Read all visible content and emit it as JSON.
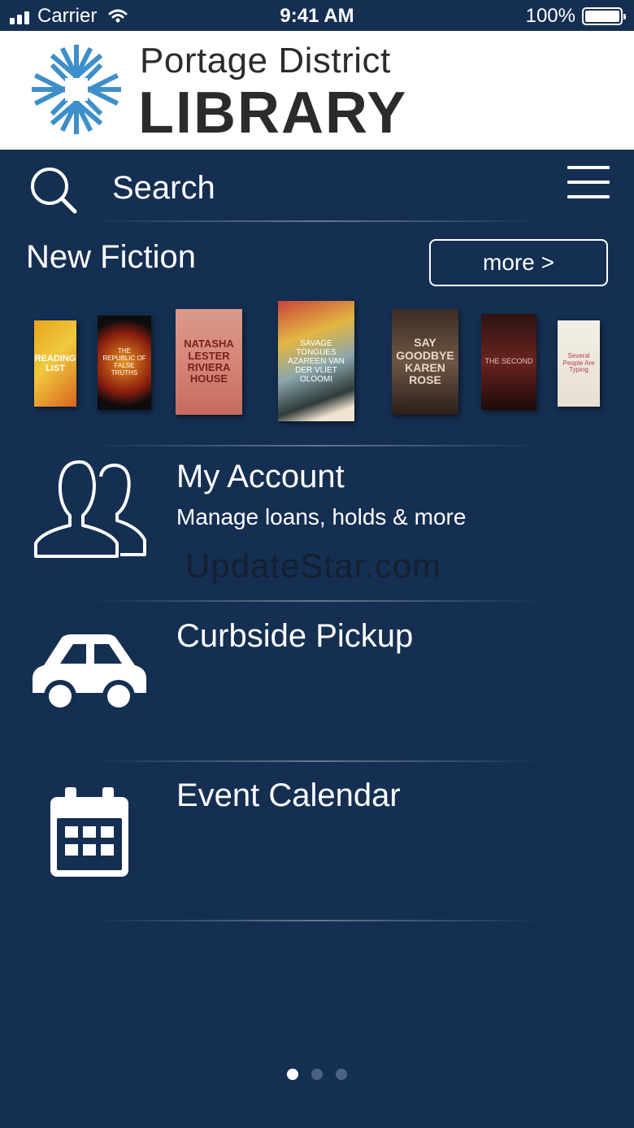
{
  "status_bar": {
    "carrier": "Carrier",
    "time": "9:41 AM",
    "battery": "100%"
  },
  "header": {
    "logo_line1": "Portage District",
    "logo_line2": "LIBRARY",
    "logo_color": "#3d8fca"
  },
  "search": {
    "placeholder": "Search",
    "icon": "search-icon"
  },
  "menu": {
    "icon": "hamburger-menu-icon"
  },
  "new_fiction": {
    "title": "New Fiction",
    "more_label": "more >",
    "covers": [
      {
        "title": "The Reading List",
        "text": "READING LIST"
      },
      {
        "title": "The Republic of False Truths",
        "text": "THE REPUBLIC OF FALSE TRUTHS"
      },
      {
        "title": "Riviera House",
        "text": "NATASHA LESTER RIVIERA HOUSE"
      },
      {
        "title": "Savage Tongues",
        "text": "SAVAGE TONGUES AZAREEN VAN DER VLIET OLOOMI"
      },
      {
        "title": "Say Goodbye",
        "text": "SAY GOODBYE KAREN ROSE"
      },
      {
        "title": "The Second Daughter",
        "text": "THE SECOND"
      },
      {
        "title": "Several People Are Typing",
        "text": "Several People Are Typing"
      }
    ]
  },
  "rows": [
    {
      "title": "My Account",
      "subtitle": "Manage loans, holds & more",
      "icon": "users-icon"
    },
    {
      "title": "Curbside Pickup",
      "subtitle": "",
      "icon": "car-icon"
    },
    {
      "title": "Event Calendar",
      "subtitle": "",
      "icon": "calendar-icon"
    }
  ],
  "watermark": "UpdateStar.com",
  "pagination": {
    "pages": 3,
    "current": 1
  }
}
